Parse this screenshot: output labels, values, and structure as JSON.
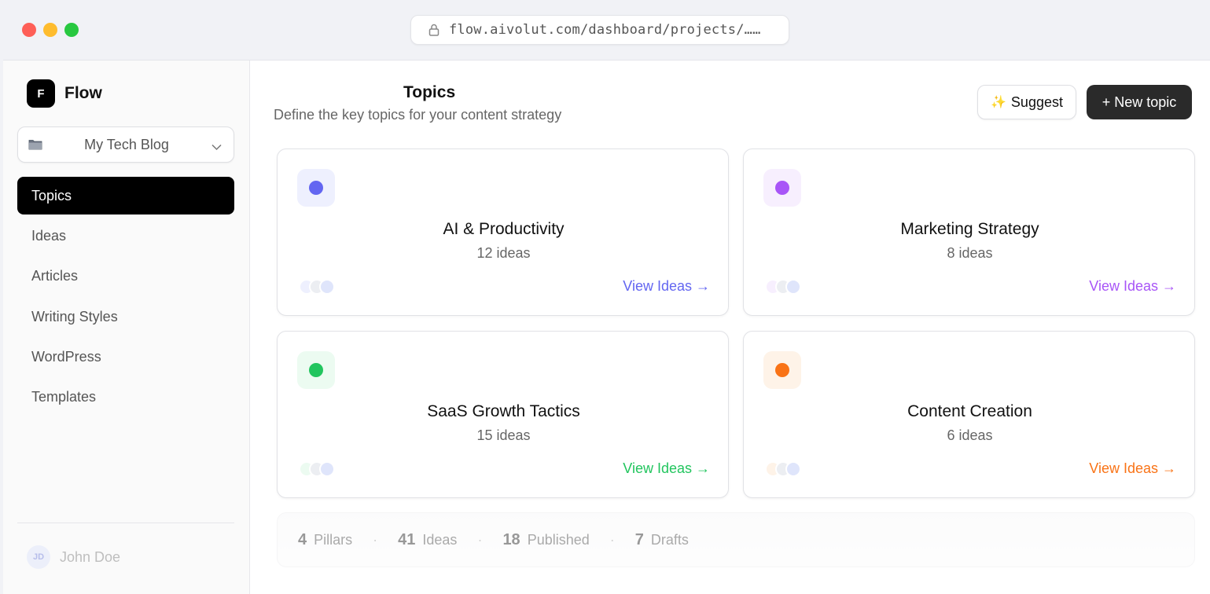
{
  "browser": {
    "url": "flow.aivolut.com/dashboard/projects/……"
  },
  "sidebar": {
    "brand_logo": "F",
    "brand_name": "Flow",
    "project": "My Tech Blog",
    "items": [
      {
        "label": "Topics",
        "active": true
      },
      {
        "label": "Ideas",
        "active": false
      },
      {
        "label": "Articles",
        "active": false
      },
      {
        "label": "Writing Styles",
        "active": false
      },
      {
        "label": "WordPress",
        "active": false
      },
      {
        "label": "Templates",
        "active": false
      }
    ],
    "user": {
      "initials": "JD",
      "name": "John Doe"
    }
  },
  "header": {
    "title": "Topics",
    "subtitle": "Define the key topics for your content strategy",
    "suggest_icon": "✨",
    "suggest_label": "Suggest",
    "new_label": "+ New topic"
  },
  "topics": [
    {
      "title": "AI & Productivity",
      "count": "12 ideas",
      "link": "View Ideas →",
      "color": "#6366f1",
      "tint": "#eef0fe"
    },
    {
      "title": "Marketing Strategy",
      "count": "8 ideas",
      "link": "View Ideas →",
      "color": "#a855f7",
      "tint": "#f7effe"
    },
    {
      "title": "SaaS Growth Tactics",
      "count": "15 ideas",
      "link": "View Ideas →",
      "color": "#22c55e",
      "tint": "#ecfbf1"
    },
    {
      "title": "Content Creation",
      "count": "6 ideas",
      "link": "View Ideas →",
      "color": "#f97316",
      "tint": "#fef3e8"
    }
  ],
  "stats": [
    {
      "value": "4",
      "label": "Pillars"
    },
    {
      "value": "41",
      "label": "Ideas"
    },
    {
      "value": "18",
      "label": "Published"
    },
    {
      "value": "7",
      "label": "Drafts"
    }
  ],
  "stat_separator": "·"
}
